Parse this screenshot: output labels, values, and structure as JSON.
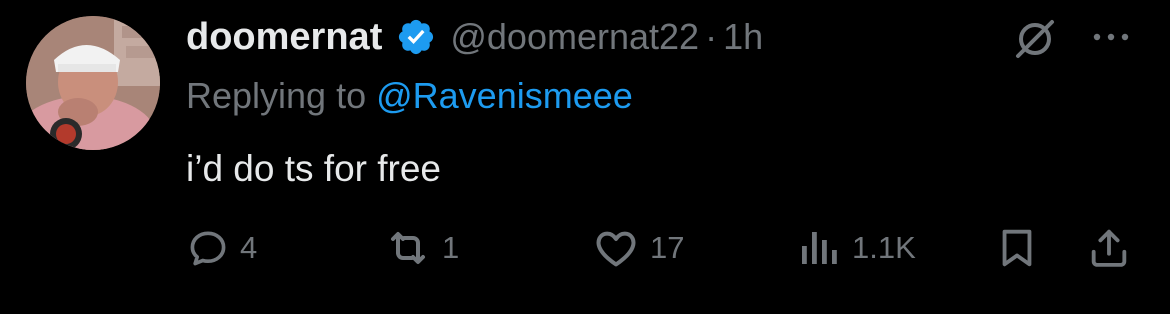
{
  "tweet": {
    "display_name": "doomernat",
    "handle": "@doomernat22",
    "separator": "·",
    "time": "1h",
    "replying_prefix": "Replying to",
    "replying_to": "@Ravenismeee",
    "text": "i’d do ts for free",
    "verified": true
  },
  "actions": {
    "replies": "4",
    "reposts": "1",
    "likes": "17",
    "views": "1.1K"
  },
  "icons": {
    "reply": "reply-icon",
    "repost": "repost-icon",
    "like": "heart-icon",
    "views": "analytics-icon",
    "bookmark": "bookmark-icon",
    "share": "share-icon",
    "grok": "grok-icon",
    "more": "more-icon",
    "verified": "verified-badge-icon"
  },
  "colors": {
    "background": "#000000",
    "text_primary": "#e7e9ea",
    "text_secondary": "#71767b",
    "accent": "#1d9bf0"
  }
}
